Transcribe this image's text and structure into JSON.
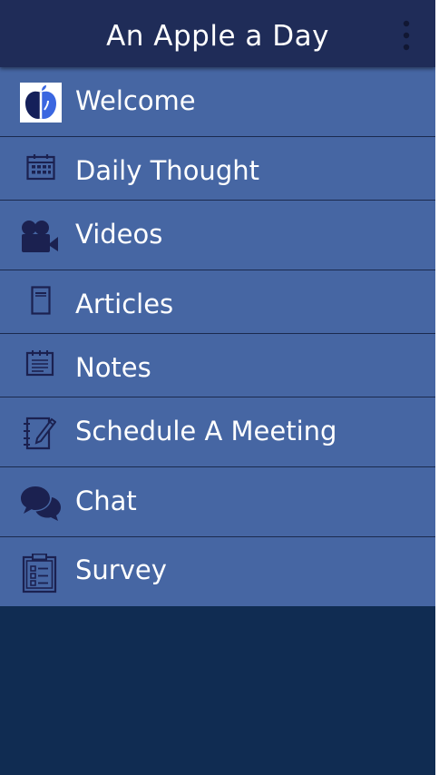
{
  "app_bar": {
    "title": "An Apple a Day",
    "overflow_icon": "more-vert-icon"
  },
  "colors": {
    "app_bar": "#1f2c58",
    "menu_background": "#4666a3",
    "divider": "#1b2a4e",
    "icon": "#1b2150",
    "page_background": "#102c52",
    "text": "#ffffff"
  },
  "menu": {
    "items": [
      {
        "label": "Welcome",
        "icon": "apple-logo-icon"
      },
      {
        "label": "Daily Thought",
        "icon": "calendar-icon"
      },
      {
        "label": "Videos",
        "icon": "video-camera-icon"
      },
      {
        "label": "Articles",
        "icon": "document-icon"
      },
      {
        "label": "Notes",
        "icon": "notepad-icon"
      },
      {
        "label": "Schedule A Meeting",
        "icon": "notebook-pen-icon"
      },
      {
        "label": "Chat",
        "icon": "chat-bubbles-icon"
      },
      {
        "label": "Survey",
        "icon": "clipboard-checklist-icon"
      }
    ]
  }
}
